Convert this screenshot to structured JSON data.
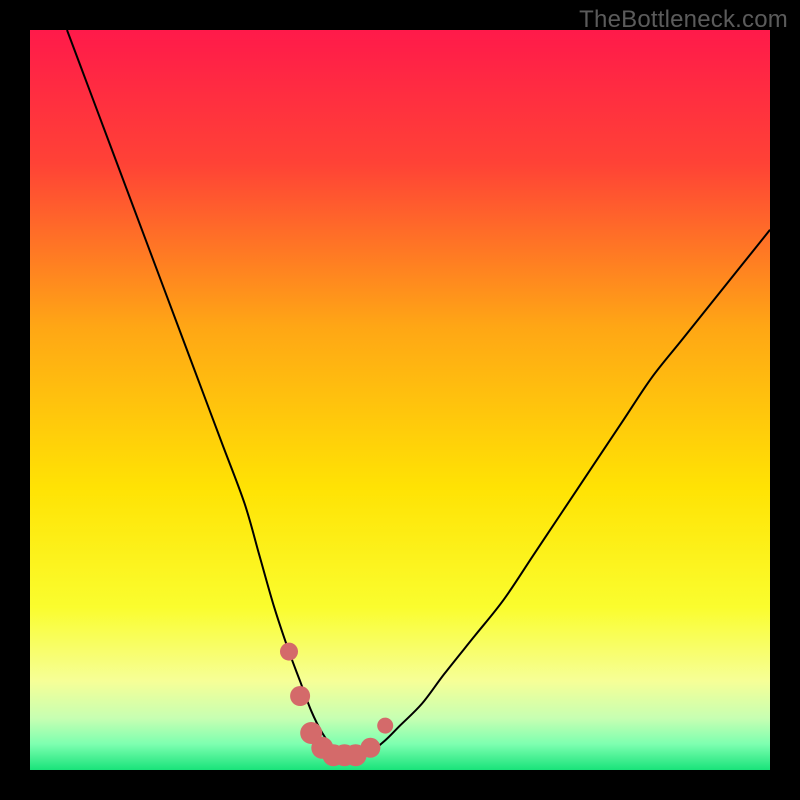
{
  "watermark": {
    "text": "TheBottleneck.com"
  },
  "colors": {
    "black": "#000000",
    "curve": "#000000",
    "marker_fill": "#d46a6a",
    "marker_stroke": "#c85a5a",
    "gradient_stops": [
      {
        "offset": 0.0,
        "color": "#ff1a4a"
      },
      {
        "offset": 0.18,
        "color": "#ff4236"
      },
      {
        "offset": 0.4,
        "color": "#ffa615"
      },
      {
        "offset": 0.62,
        "color": "#ffe304"
      },
      {
        "offset": 0.78,
        "color": "#fafd2e"
      },
      {
        "offset": 0.88,
        "color": "#f6ff97"
      },
      {
        "offset": 0.93,
        "color": "#c7ffb2"
      },
      {
        "offset": 0.965,
        "color": "#7dffb0"
      },
      {
        "offset": 1.0,
        "color": "#19e37a"
      }
    ]
  },
  "chart_data": {
    "type": "line",
    "title": "",
    "xlabel": "",
    "ylabel": "",
    "xlim": [
      0,
      100
    ],
    "ylim": [
      0,
      100
    ],
    "grid": false,
    "legend": false,
    "series": [
      {
        "name": "bottleneck-curve",
        "x": [
          5,
          8,
          11,
          14,
          17,
          20,
          23,
          26,
          29,
          31,
          33,
          35,
          36.5,
          38,
          39.5,
          41,
          42.5,
          44,
          46,
          48,
          50,
          53,
          56,
          60,
          64,
          68,
          72,
          76,
          80,
          84,
          88,
          92,
          96,
          100
        ],
        "y": [
          100,
          92,
          84,
          76,
          68,
          60,
          52,
          44,
          36,
          29,
          22,
          16,
          12,
          8,
          5,
          3,
          2,
          2,
          2.5,
          4,
          6,
          9,
          13,
          18,
          23,
          29,
          35,
          41,
          47,
          53,
          58,
          63,
          68,
          73
        ]
      }
    ],
    "markers": {
      "name": "optimal-range-markers",
      "x": [
        35,
        36.5,
        38,
        39.5,
        41,
        42.5,
        44,
        46,
        48
      ],
      "y": [
        16,
        10,
        5,
        3,
        2,
        2,
        2,
        3,
        6
      ],
      "size": [
        9,
        10,
        11,
        11,
        11,
        11,
        11,
        10,
        8
      ]
    }
  }
}
